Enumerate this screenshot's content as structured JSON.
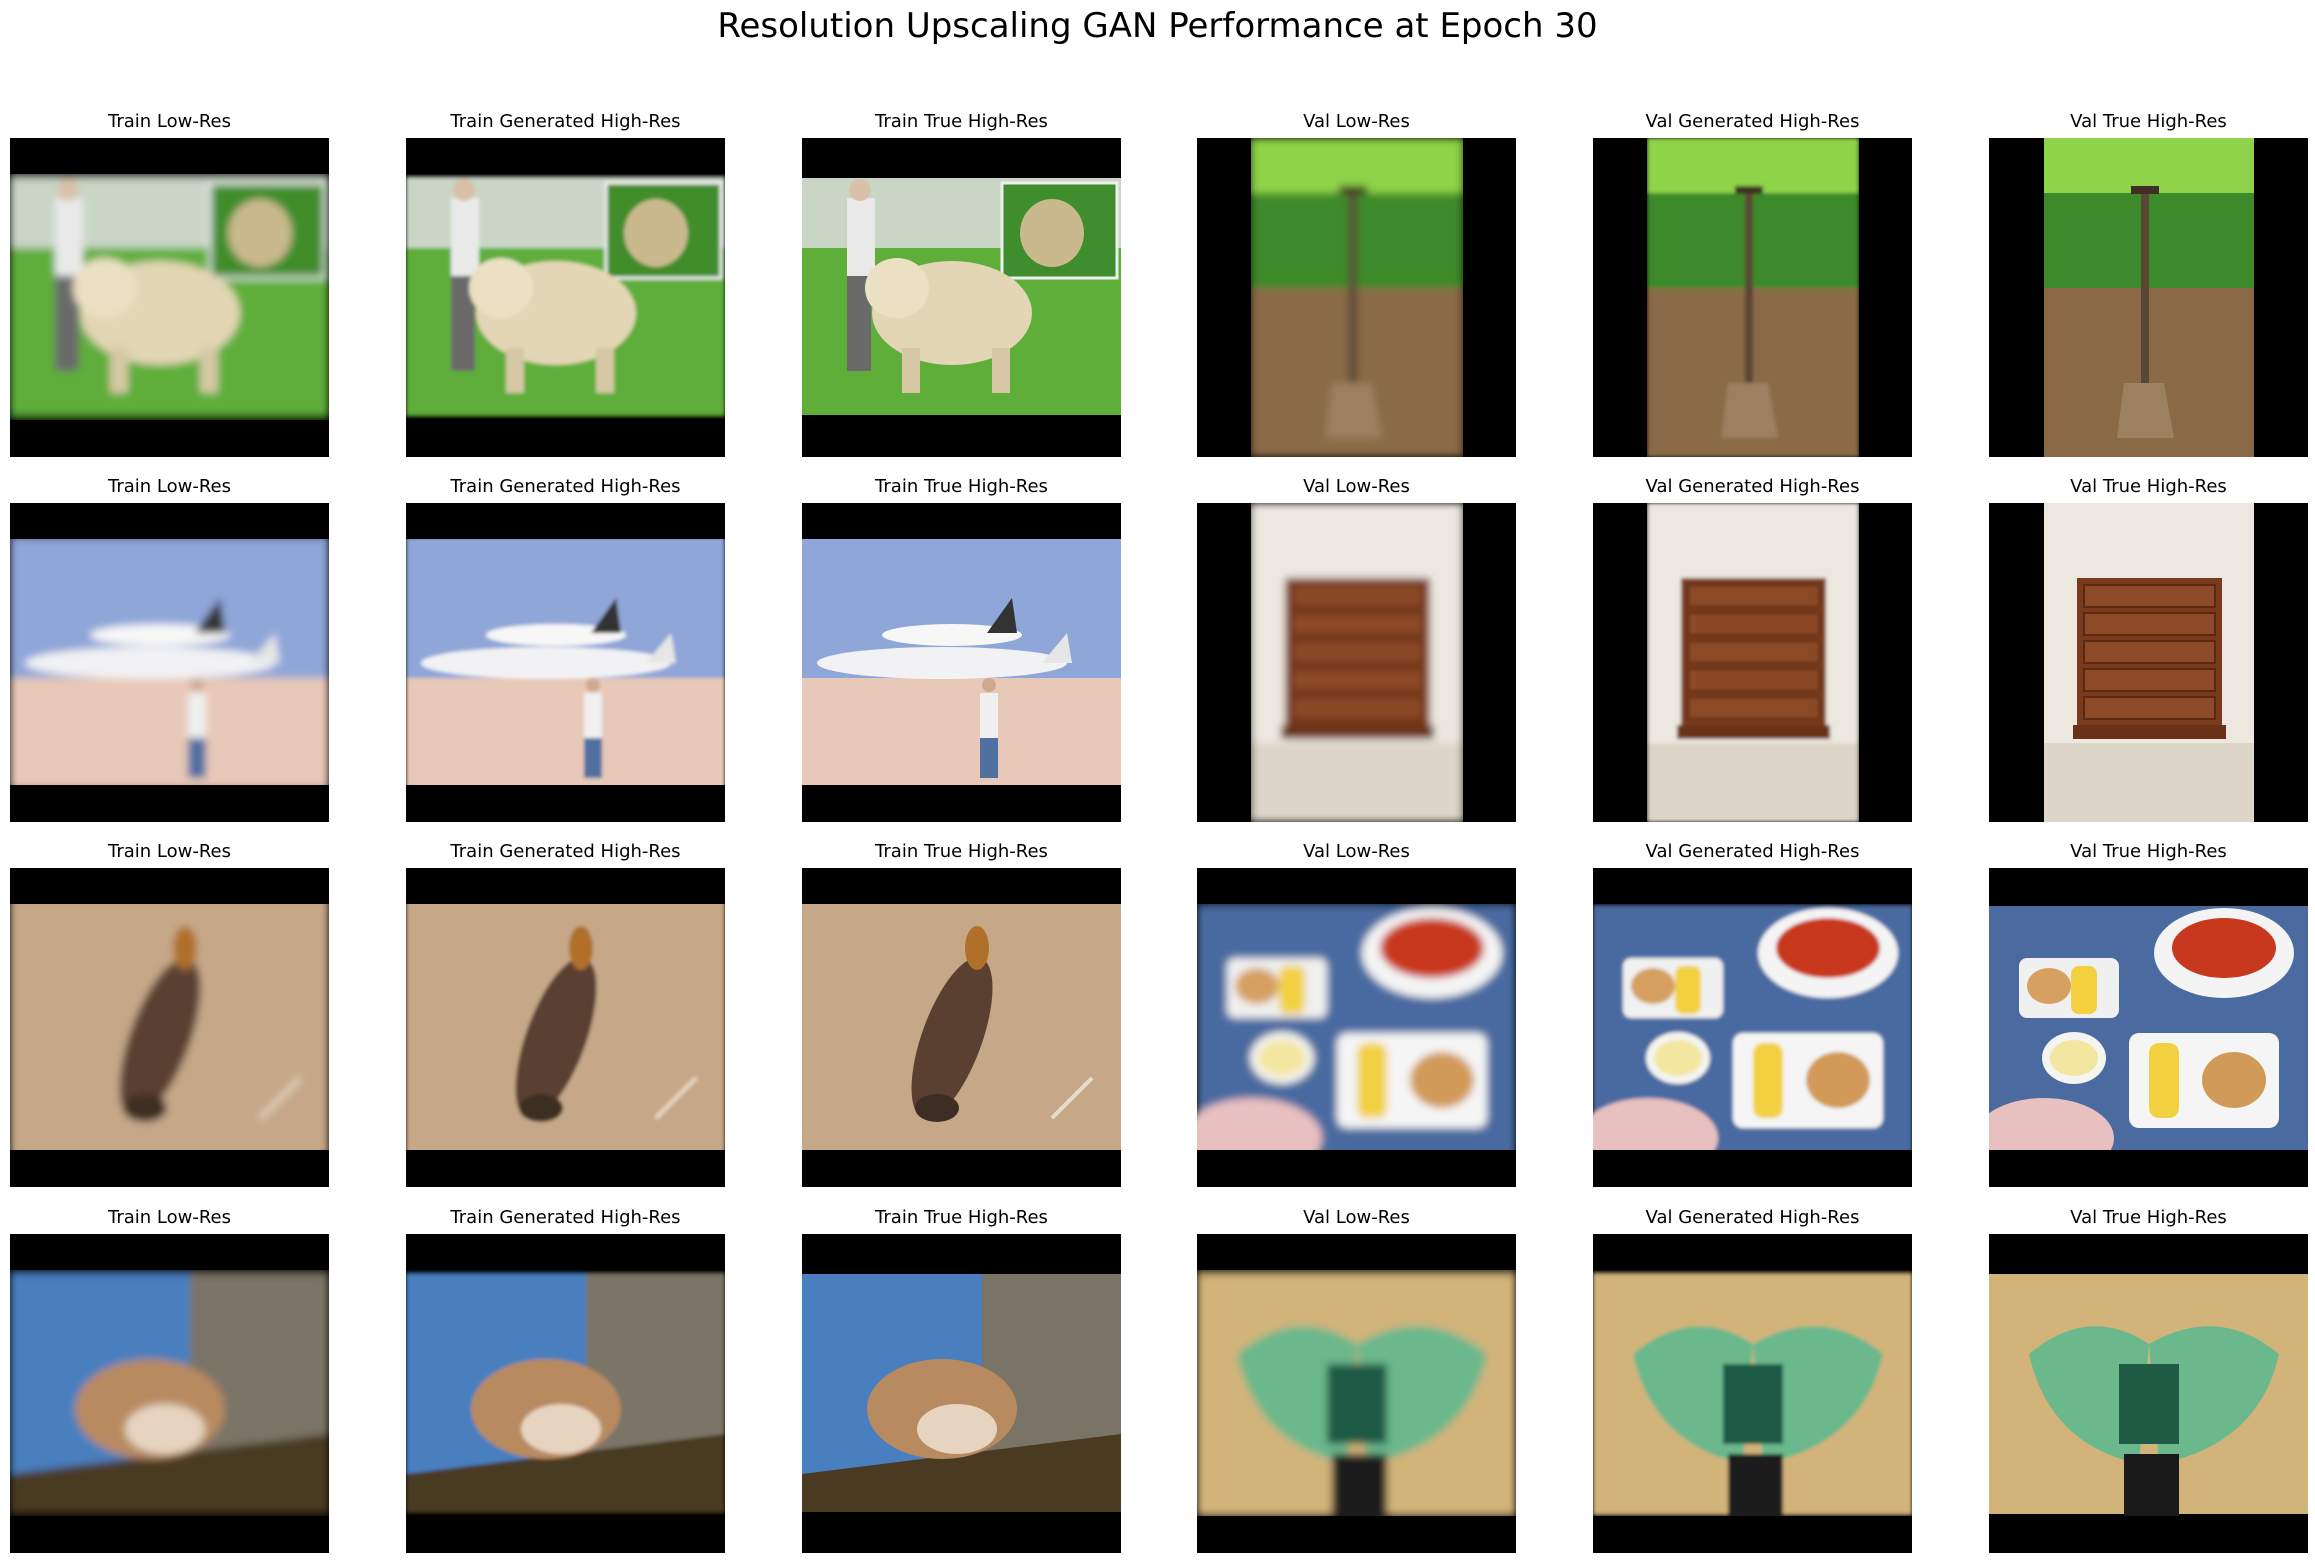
{
  "figure": {
    "title": "Resolution Upscaling GAN Performance at Epoch 30"
  },
  "column_titles": [
    "Train Low-Res",
    "Train Generated High-Res",
    "Train True High-Res",
    "Val Low-Res",
    "Val Generated High-Res",
    "Val True High-Res"
  ],
  "rows": [
    {
      "train_subject": "man-with-sheepdogs-on-grass",
      "val_subject": "spade-in-soil-before-green-hedge",
      "train_letterbox": "horizontal",
      "val_letterbox": "vertical"
    },
    {
      "train_subject": "space-shuttle-on-carrier-plane-at-airfield",
      "val_subject": "wooden-chest-of-drawers",
      "train_letterbox": "horizontal",
      "val_letterbox": "vertical"
    },
    {
      "train_subject": "crayfish-on-sand",
      "val_subject": "lobster-corn-and-buns-on-picnic-table",
      "train_letterbox": "horizontal",
      "val_letterbox": "horizontal"
    },
    {
      "train_subject": "squirrel-on-tree-branch",
      "val_subject": "green-fender-guitar-picks",
      "train_letterbox": "horizontal",
      "val_letterbox": "horizontal"
    }
  ],
  "colors": {
    "background": "#ffffff",
    "letterbox": "#000000"
  }
}
